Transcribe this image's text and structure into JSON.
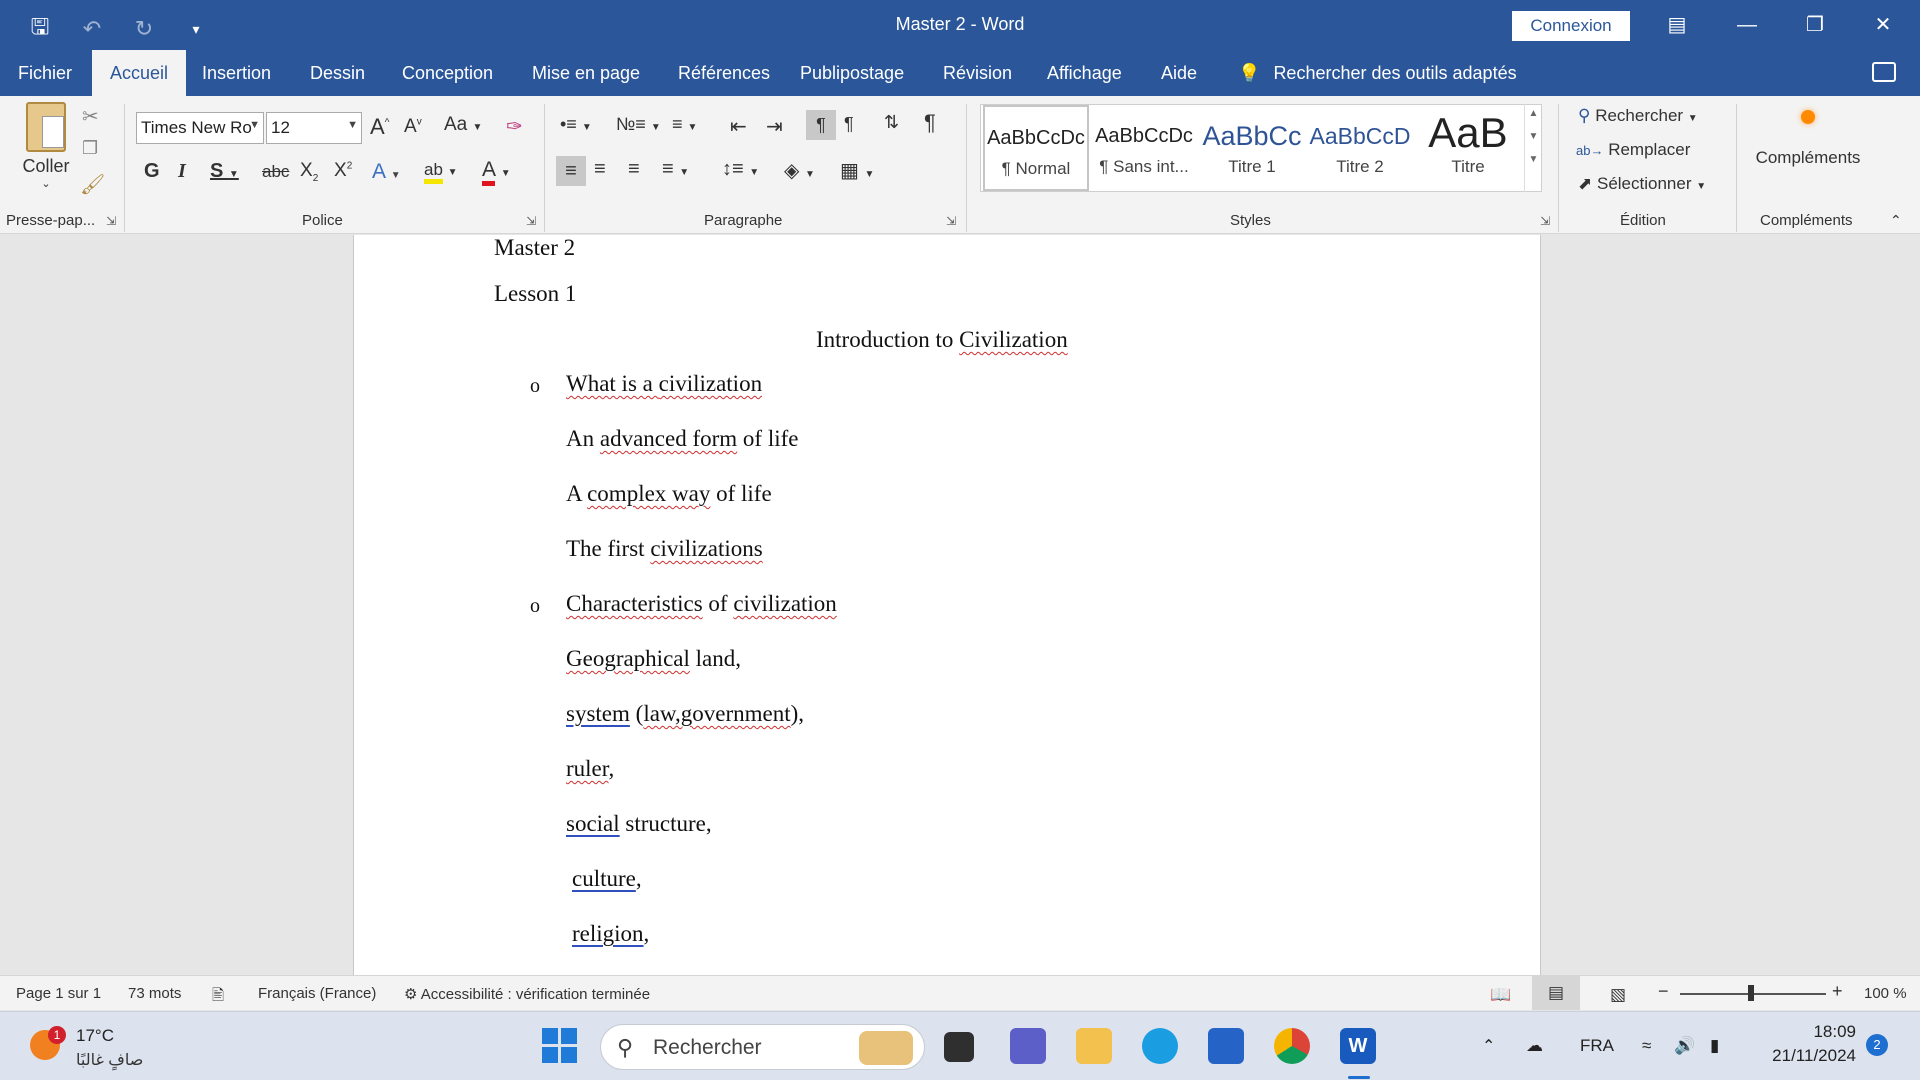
{
  "window": {
    "title": "Master 2  -  Word",
    "signin_label": "Connexion"
  },
  "quick_access": [
    "save-icon",
    "undo-icon",
    "redo-icon",
    "customize-icon"
  ],
  "tabs": [
    {
      "label": "Fichier"
    },
    {
      "label": "Accueil"
    },
    {
      "label": "Insertion"
    },
    {
      "label": "Dessin"
    },
    {
      "label": "Conception"
    },
    {
      "label": "Mise en page"
    },
    {
      "label": "Références"
    },
    {
      "label": "Publipostage"
    },
    {
      "label": "Révision"
    },
    {
      "label": "Affichage"
    },
    {
      "label": "Aide"
    }
  ],
  "tell_me": "Rechercher des outils adaptés",
  "ribbon": {
    "clipboard": {
      "paste_label": "Coller",
      "group_label": "Presse-pap..."
    },
    "font": {
      "family": "Times New Ro",
      "size": "12",
      "case_label": "Aa",
      "group_label": "Police"
    },
    "paragraph": {
      "group_label": "Paragraphe"
    },
    "styles": {
      "group_label": "Styles",
      "items": [
        {
          "preview": "AaBbCcDc",
          "name": "¶ Normal"
        },
        {
          "preview": "AaBbCcDc",
          "name": "¶ Sans int..."
        },
        {
          "preview": "AaBbCc",
          "name": "Titre 1"
        },
        {
          "preview": "AaBbCcD",
          "name": "Titre 2"
        },
        {
          "preview": "AaB",
          "name": "Titre"
        }
      ]
    },
    "editing": {
      "find": "Rechercher",
      "replace": "Remplacer",
      "select": "Sélectionner",
      "group_label": "Édition"
    },
    "addins": {
      "label": "Compléments",
      "group_label": "Compléments"
    }
  },
  "document": {
    "line1": "Master 2",
    "line2": "Lesson 1",
    "heading": {
      "a": "Introduction to ",
      "b": "Civilization"
    },
    "b1": {
      "a": "What is a ",
      "b": "civilization"
    },
    "s1": {
      "a": "An ",
      "b": "advanced form",
      "c": " of life"
    },
    "s2": {
      "a": "A ",
      "b": "complex way",
      "c": " of life"
    },
    "s3": {
      "a": "The first ",
      "b": "civilizations"
    },
    "b2": {
      "a": "Characteristics",
      "b": " of ",
      "c": "civilization"
    },
    "c1": {
      "a": "Geographical",
      "b": " land,"
    },
    "c2": {
      "a": "system",
      "b": " (",
      "c": "law,government",
      "d": "),"
    },
    "c3": {
      "a": "ruler",
      "b": ","
    },
    "c4": {
      "a": "social",
      "b": " structure,"
    },
    "c5": {
      "a": "culture",
      "b": ","
    },
    "c6": {
      "a": "religion",
      "b": ","
    }
  },
  "status": {
    "page": "Page 1 sur 1",
    "words": "73 mots",
    "language": "Français (France)",
    "accessibility": "Accessibilité : vérification terminée",
    "zoom": "100 %"
  },
  "taskbar": {
    "weather_temp": "17°C",
    "weather_desc": "صافٍ غالبًا",
    "weather_badge": "1",
    "search_placeholder": "Rechercher",
    "lang": "FRA",
    "time": "18:09",
    "date": "21/11/2024",
    "notif_count": "2"
  },
  "colors": {
    "word_blue": "#2b579a",
    "spell_red": "#d03030",
    "grammar_blue": "#3050c0"
  }
}
